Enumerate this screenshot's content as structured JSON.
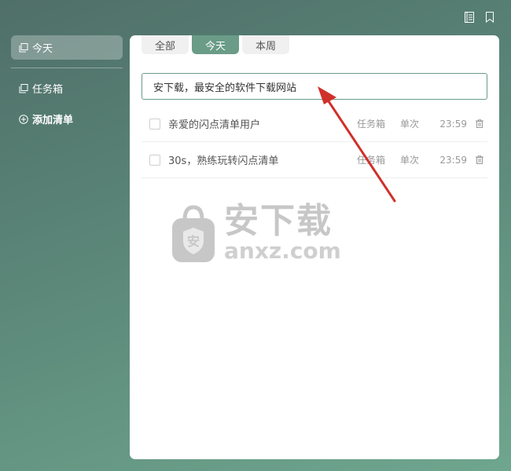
{
  "sidebar": {
    "items": [
      {
        "label": "今天",
        "icon": "copy-icon",
        "active": true
      },
      {
        "label": "任务箱",
        "icon": "copy-icon",
        "active": false
      }
    ],
    "add_label": "添加清单"
  },
  "tabs": [
    {
      "label": "全部",
      "active": false
    },
    {
      "label": "今天",
      "active": true
    },
    {
      "label": "本周",
      "active": false
    }
  ],
  "input": {
    "value": "安下载，最安全的软件下载网站"
  },
  "tasks": [
    {
      "title": "亲爱的闪点清单用户",
      "list": "任务箱",
      "repeat": "单次",
      "time": "23:59"
    },
    {
      "title": "30s，熟练玩转闪点清单",
      "list": "任务箱",
      "repeat": "单次",
      "time": "23:59"
    }
  ],
  "watermark": {
    "cn": "安下载",
    "en": "anxz.com",
    "badge": "安"
  },
  "colors": {
    "accent": "#6a9c88",
    "arrow": "#d0302a"
  }
}
